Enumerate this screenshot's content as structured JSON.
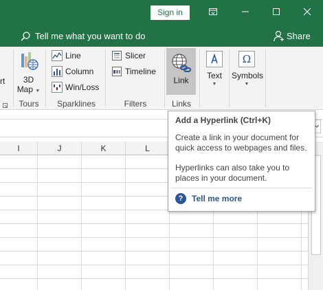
{
  "titlebar": {
    "signin_label": "Sign in",
    "controls": [
      "ribbon-display-icon",
      "minimize-icon",
      "maximize-icon",
      "close-icon"
    ]
  },
  "tellbar": {
    "search_text": "Tell me what you want to do",
    "share_label": "Share"
  },
  "ribbon": {
    "partial_left_label": "rt",
    "tours": {
      "button_label": "3D",
      "button_label2": "Map",
      "group_label": "Tours"
    },
    "sparklines": {
      "items": [
        "Line",
        "Column",
        "Win/Loss"
      ],
      "group_label": "Sparklines"
    },
    "filters": {
      "items": [
        "Slicer",
        "Timeline"
      ],
      "group_label": "Filters"
    },
    "links": {
      "button_label": "Link",
      "group_label": "Links"
    },
    "text": {
      "button_label": "Text"
    },
    "symbols": {
      "button_label": "Symbols"
    }
  },
  "grid": {
    "columns": [
      "I",
      "J",
      "K",
      "L"
    ]
  },
  "tooltip": {
    "title": "Add a Hyperlink (Ctrl+K)",
    "body1": "Create a link in your document for quick access to webpages and files.",
    "body2": "Hyperlinks can also take you to places in your document.",
    "more_label": "Tell me more"
  },
  "colors": {
    "accent": "#217346",
    "link_blue": "#2b579a",
    "ribbon_bg": "#f3f3f3",
    "selected_button": "#c5c5c5"
  }
}
